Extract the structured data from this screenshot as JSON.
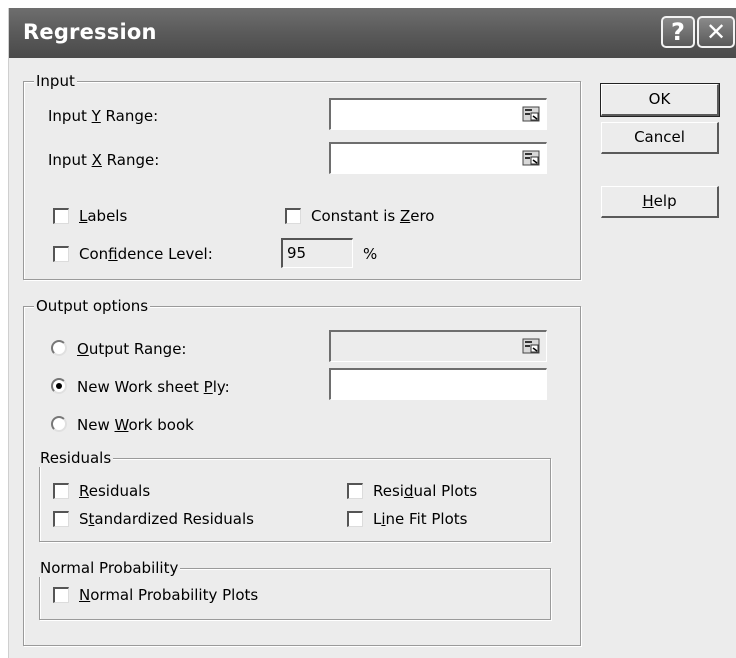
{
  "window": {
    "title": "Regression",
    "help_glyph": "?",
    "close_glyph": "✕"
  },
  "input_group": {
    "label": "Input",
    "y_range": {
      "pre": "Input ",
      "key": "Y",
      "post": " Range:",
      "value": ""
    },
    "x_range": {
      "pre": "Input ",
      "key": "X",
      "post": " Range:",
      "value": ""
    },
    "labels": {
      "pre": "",
      "key": "L",
      "post": "abels",
      "checked": false
    },
    "constant_zero": {
      "pre": "Constant is ",
      "key": "Z",
      "post": "ero",
      "checked": false
    },
    "confidence": {
      "pre": "Con",
      "key": "f",
      "post": "idence Level:",
      "checked": false,
      "value": "95",
      "unit": "%"
    }
  },
  "output_group": {
    "label": "Output options",
    "output_range": {
      "pre": "",
      "key": "O",
      "post": "utput Range:",
      "selected": false,
      "value": ""
    },
    "new_sheet": {
      "pre": "New Work sheet ",
      "key": "P",
      "post": "ly:",
      "selected": true,
      "value": ""
    },
    "new_book": {
      "pre": "New ",
      "key": "W",
      "post": "ork book",
      "selected": false
    }
  },
  "residuals_group": {
    "label": "Residuals",
    "residuals": {
      "pre": "",
      "key": "R",
      "post": "esiduals",
      "checked": false
    },
    "standardized": {
      "pre": "S",
      "key": "t",
      "post": "andardized Residuals",
      "checked": false
    },
    "residual_plots": {
      "pre": "Resi",
      "key": "d",
      "post": "ual Plots",
      "checked": false
    },
    "line_fit": {
      "pre": "L",
      "key": "i",
      "post": "ne Fit Plots",
      "checked": false
    }
  },
  "normal_group": {
    "label": "Normal Probability",
    "plots": {
      "pre": "",
      "key": "N",
      "post": "ormal Probability Plots",
      "checked": false
    }
  },
  "buttons": {
    "ok": "OK",
    "cancel": "Cancel",
    "help": {
      "pre": "",
      "key": "H",
      "post": "elp"
    }
  },
  "icons": {
    "range_picker": "range-picker-icon"
  }
}
